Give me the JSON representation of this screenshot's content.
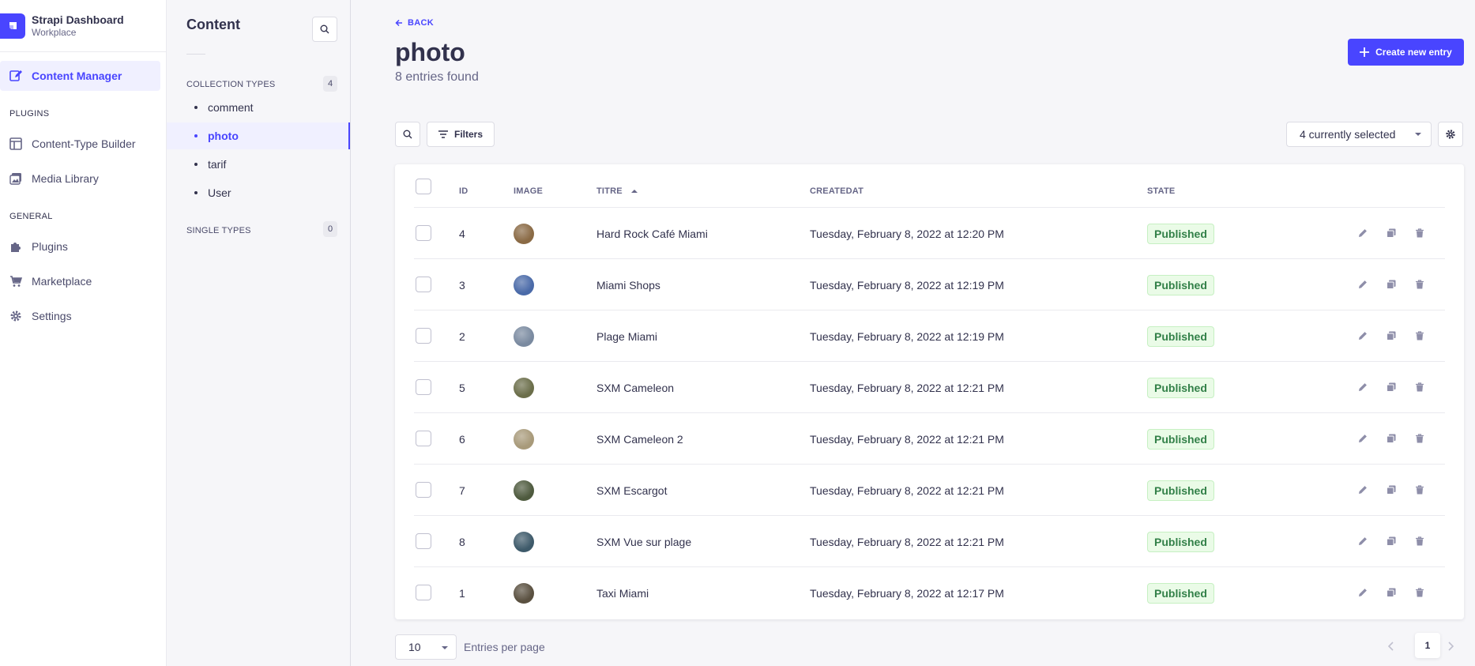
{
  "brand": {
    "title": "Strapi Dashboard",
    "subtitle": "Workplace"
  },
  "mainnav": {
    "content_manager": "Content Manager",
    "plugins_section": "PLUGINS",
    "content_type_builder": "Content-Type Builder",
    "media_library": "Media Library",
    "general_section": "GENERAL",
    "plugins": "Plugins",
    "marketplace": "Marketplace",
    "settings": "Settings"
  },
  "subnav": {
    "title": "Content",
    "collection_types_label": "COLLECTION TYPES",
    "collection_types_count": "4",
    "collection_types": [
      "comment",
      "photo",
      "tarif",
      "User"
    ],
    "single_types_label": "SINGLE TYPES",
    "single_types_count": "0"
  },
  "header": {
    "back_label": "BACK",
    "title": "photo",
    "subtitle": "8 entries found",
    "create_button": "Create new entry"
  },
  "toolbar": {
    "filters_label": "Filters",
    "columns_select": "4 currently selected"
  },
  "table": {
    "headers": {
      "id": "ID",
      "image": "IMAGE",
      "titre": "TITRE",
      "createdat": "CREATEDAT",
      "state": "STATE"
    },
    "rows": [
      {
        "id": "4",
        "titre": "Hard Rock Café Miami",
        "createdat": "Tuesday, February 8, 2022 at 12:20 PM",
        "state": "Published",
        "thumb_color": "#8a6a45"
      },
      {
        "id": "3",
        "titre": "Miami Shops",
        "createdat": "Tuesday, February 8, 2022 at 12:19 PM",
        "state": "Published",
        "thumb_color": "#4a6aa8"
      },
      {
        "id": "2",
        "titre": "Plage Miami",
        "createdat": "Tuesday, February 8, 2022 at 12:19 PM",
        "state": "Published",
        "thumb_color": "#7a8aa0"
      },
      {
        "id": "5",
        "titre": "SXM Cameleon",
        "createdat": "Tuesday, February 8, 2022 at 12:21 PM",
        "state": "Published",
        "thumb_color": "#6b6e4a"
      },
      {
        "id": "6",
        "titre": "SXM Cameleon 2",
        "createdat": "Tuesday, February 8, 2022 at 12:21 PM",
        "state": "Published",
        "thumb_color": "#a89a7a"
      },
      {
        "id": "7",
        "titre": "SXM Escargot",
        "createdat": "Tuesday, February 8, 2022 at 12:21 PM",
        "state": "Published",
        "thumb_color": "#4e5a3e"
      },
      {
        "id": "8",
        "titre": "SXM Vue sur plage",
        "createdat": "Tuesday, February 8, 2022 at 12:21 PM",
        "state": "Published",
        "thumb_color": "#3e5a6a"
      },
      {
        "id": "1",
        "titre": "Taxi Miami",
        "createdat": "Tuesday, February 8, 2022 at 12:17 PM",
        "state": "Published",
        "thumb_color": "#5a5040"
      }
    ]
  },
  "pagination": {
    "per_page": "10",
    "per_page_label": "Entries per page",
    "current_page": "1"
  },
  "colors": {
    "accent": "#4945ff",
    "published_bg": "#eafbe7",
    "published_text": "#328048"
  }
}
